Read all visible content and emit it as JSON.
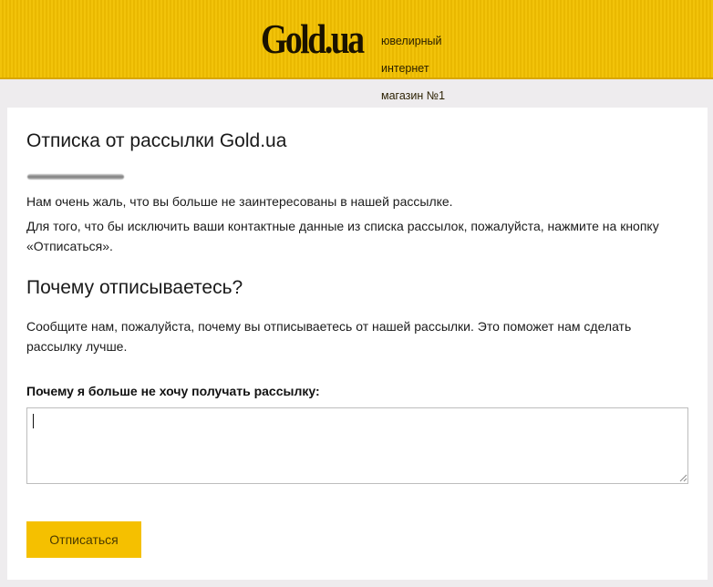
{
  "header": {
    "logo_text": "Gold.ua",
    "tagline": [
      "ювелирный",
      "интернет",
      "магазин №1"
    ],
    "brand_color": "#f2c30a"
  },
  "main": {
    "title": "Отписка от рассылки Gold.ua",
    "sorry_text": "Нам очень жаль, что вы больше не заинтересованы в нашей рассылке.",
    "instructions_text": "Для того, что бы исключить ваши контактные данные из списка рассылок, пожалуйста, нажмите на кнопку «Отписаться».",
    "why_title": "Почему отписываетесь?",
    "why_text": "Сообщите нам, пожалуйста, почему вы отписываетесь от нашей рассылки. Это поможет нам сделать рассылку лучше.",
    "reason_label": "Почему я больше не хочу получать рассылку:",
    "reason_value": "",
    "unsubscribe_label": "Отписаться",
    "button_color": "#f5c000"
  }
}
